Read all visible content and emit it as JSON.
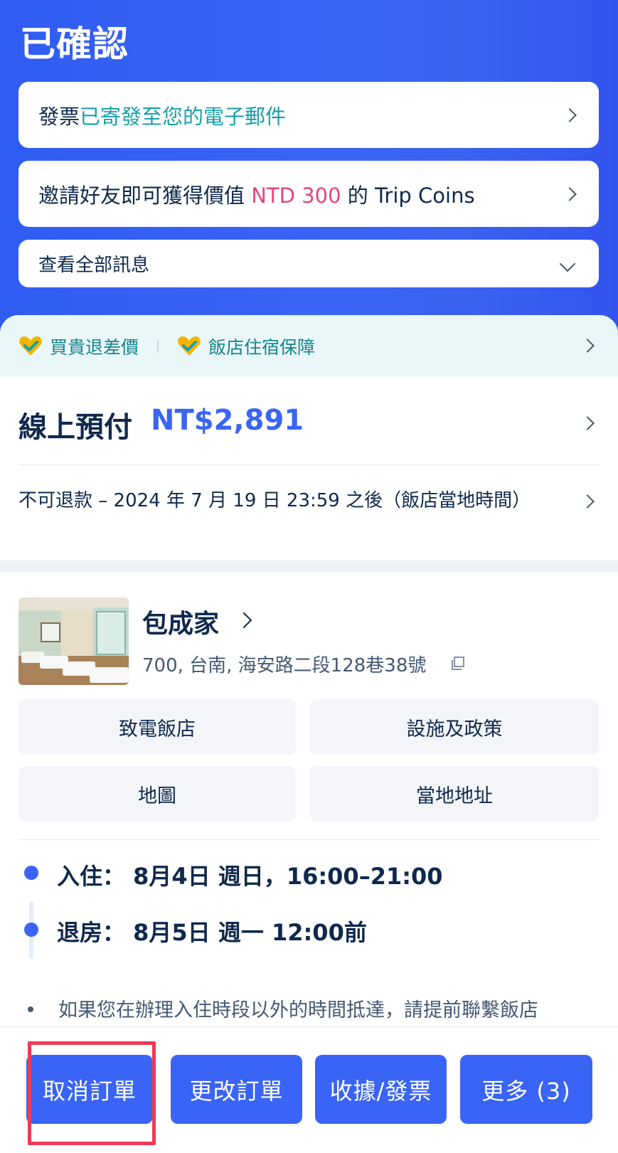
{
  "header": {
    "status_title": "已確認",
    "invoice_msg": {
      "prefix": "發票",
      "highlight": "已寄發至您的電子郵件"
    },
    "invite_msg": {
      "prefix": "邀請好友即可獲得價值 ",
      "amount": "NTD 300",
      "suffix": " 的 Trip Coins"
    },
    "view_all": "查看全部訊息"
  },
  "guarantees": [
    {
      "label": "買貴退差價",
      "icon": "heart-check-icon"
    },
    {
      "label": "飯店住宿保障",
      "icon": "heart-check-icon"
    }
  ],
  "payment": {
    "label": "線上預付",
    "amount": "NT$2,891",
    "policy": "不可退款 – 2024 年 7 月 19 日 23:59 之後（飯店當地時間）"
  },
  "hotel": {
    "name": "包成家",
    "address": "700, 台南, 海安路二段128巷38號"
  },
  "actions": {
    "call": "致電飯店",
    "facilities": "設施及政策",
    "map": "地圖",
    "local_address": "當地地址"
  },
  "stay": {
    "checkin_label": "入住：",
    "checkin_value": "8月4日 週日，16:00–21:00",
    "checkout_label": "退房：",
    "checkout_value": "8月5日 週一 12:00前",
    "note": "如果您在辦理入住時段以外的時間抵達，請提前聯繫飯店"
  },
  "bottom_buttons": {
    "cancel": "取消訂單",
    "modify": "更改訂單",
    "receipt": "收據/發票",
    "more": "更多 (3)"
  },
  "colors": {
    "brand_blue": "#3a64f5",
    "teal": "#17a0a8",
    "pink": "#e8447a",
    "highlight_red": "#ee3b55"
  }
}
